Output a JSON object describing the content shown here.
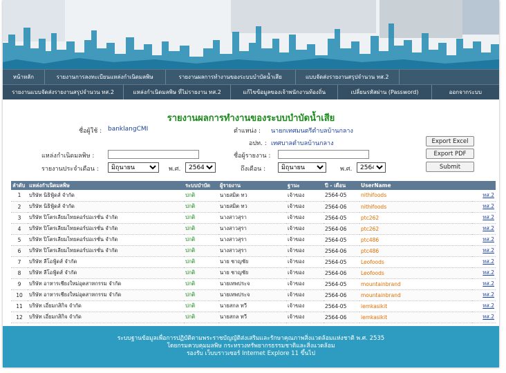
{
  "banner": {
    "sky_color": "#f4f6f8",
    "skyline_color": "#2e8fb5",
    "skyline_path": "M0,70 L0,80 L10,80 L10,60 L18,60 … L718,100 Z"
  },
  "menu": {
    "row1": [
      "หน้าหลัก",
      "รายงานการลงทะเบียนแหล่งกำเนิดมลพิษ",
      "รายงานผลการทำงานของระบบบำบัดน้ำเสีย",
      "แบบจัดส่งรายงานสรุปจำนวน ทส.2"
    ],
    "row2": [
      "รายงานแบบจัดส่งรายงานสรุปจำนวน ทส.2",
      "แหล่งกำเนิดมลพิษ ที่ไม่รายงาน ทส.2",
      "แก้ไขข้อมูลของเจ้าพนักงานท้องถิ่น",
      "เปลี่ยนรหัสผ่าน (Password)",
      "ออกจากระบบ"
    ]
  },
  "page": {
    "title": "รายงานผลการทำงานของระบบบำบัดน้ำเสีย"
  },
  "info": {
    "user_label": "ชื่อผู้ใช้ :",
    "user_value": "banklangCMI",
    "position_label": "ตำแหน่ง :",
    "position_value": "นายกเทศมนตรีตำบลบ้านกลาง",
    "org_label": "อปท. :",
    "org_value": "เทศบาลตำบลบ้านกลาง"
  },
  "form": {
    "source_label": "แหล่งกำเนิดมลพิษ :",
    "reporter_label": "ชื่อผู้รายงาน :",
    "month_label": "รายงานประจำเดือน :",
    "year_label": "พ.ศ.",
    "to_month_label": "ถึงเดือน :",
    "to_year_label": "พ.ศ.",
    "month_selected": "มิถุนายน",
    "year_selected": "2564",
    "to_month_selected": "มิถุนายน",
    "to_year_selected": "2564",
    "export_excel": "Export Excel",
    "export_pdf": "Export PDF",
    "submit": "Submit"
  },
  "table": {
    "headers": [
      "ลำดับ",
      "แหล่งกำเนิดมลพิษ",
      "ระบบบำบัด",
      "ผู้รายงาน",
      "ฐานะ",
      "ปี - เดือน",
      "UserName",
      ""
    ],
    "rows": [
      [
        "1",
        "บริษัท นิธิฟู้ดส์ จำกัด",
        "ปกติ",
        "นายสมิต ทว",
        "เจ้าของ",
        "2564-05",
        "nithifoods",
        "ทส.2"
      ],
      [
        "2",
        "บริษัท นิธิฟู้ดส์ จำกัด",
        "ปกติ",
        "นายสมิต ทว",
        "เจ้าของ",
        "2564-06",
        "nithifoods",
        "ทส.2"
      ],
      [
        "3",
        "บริษัท ปิโตรเลียมไทยคอร์ปอเรชั่น จำกัด",
        "ปกติ",
        "นางสาวสุรา",
        "เจ้าของ",
        "2564-05",
        "ptc262",
        "ทส.2"
      ],
      [
        "4",
        "บริษัท ปิโตรเลียมไทยคอร์ปอเรชั่น จำกัด",
        "ปกติ",
        "นางสาวสุรา",
        "เจ้าของ",
        "2564-06",
        "ptc262",
        "ทส.2"
      ],
      [
        "5",
        "บริษัท ปิโตรเลียมไทยคอร์ปอเรชั่น จำกัด",
        "ปกติ",
        "นางสาวสุรา",
        "เจ้าของ",
        "2564-05",
        "ptc486",
        "ทส.2"
      ],
      [
        "6",
        "บริษัท ปิโตรเลียมไทยคอร์ปอเรชั่น จำกัด",
        "ปกติ",
        "นางสาวสุรา",
        "เจ้าของ",
        "2564-06",
        "ptc486",
        "ทส.2"
      ],
      [
        "7",
        "บริษัท ลีโอฟู้ดส์ จำกัด",
        "ปกติ",
        "นาย ชาญชัย",
        "เจ้าของ",
        "2564-05",
        "Leofoods",
        "ทส.2"
      ],
      [
        "8",
        "บริษัท ลีโอฟู้ดส์ จำกัด",
        "ปกติ",
        "นาย ชาญชัย",
        "เจ้าของ",
        "2564-06",
        "Leofoods",
        "ทส.2"
      ],
      [
        "9",
        "บริษัท อาหารเชียงใหม่อุตสาหกรรม จำกัด",
        "ปกติ",
        "นายเทพประจ",
        "เจ้าของ",
        "2564-05",
        "mountainbrand",
        "ทส.2"
      ],
      [
        "10",
        "บริษัท อาหารเชียงใหม่อุตสาหกรรม จำกัด",
        "ปกติ",
        "นายเทพประจ",
        "เจ้าของ",
        "2564-06",
        "mountainbrand",
        "ทส.2"
      ],
      [
        "11",
        "บริษัท เอี่ยมกสิกิจ จำกัด",
        "ปกติ",
        "นายสกล ทวี",
        "เจ้าของ",
        "2564-05",
        "iemkasikit",
        "ทส.2"
      ],
      [
        "12",
        "บริษัท เอี่ยมกสิกิจ จำกัด",
        "ปกติ",
        "นายสกล ทวี",
        "เจ้าของ",
        "2564-06",
        "iemkasikit",
        "ทส.2"
      ]
    ]
  },
  "footer": {
    "line1": "ระบบฐานข้อมูลเพื่อการปฏิบัติตามพระราชบัญญัติส่งเสริมและรักษาคุณภาพสิ่งแวดล้อมแห่งชาติ พ.ศ. 2535",
    "line2": "โดยกรมควบคุมมลพิษ กระทรวงทรัพยากรธรรมชาติและสิ่งแวดล้อม",
    "line3": "รองรับ เว็บบราวเซอร์ Internet Explore 11 ขึ้นไป"
  },
  "colors": {
    "menu_bg": "#3a556b",
    "title_green": "#1a8a1a",
    "table_header": "#5d7993",
    "footer_bg": "#2d9cc0",
    "link_blue": "#1b3fb0",
    "user_orange": "#e07000"
  }
}
